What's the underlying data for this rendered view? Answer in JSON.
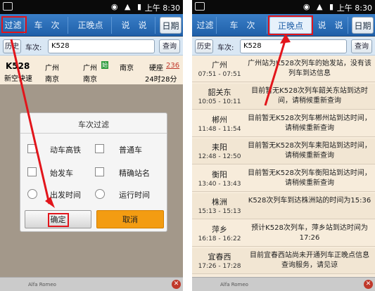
{
  "status_bar": {
    "time": "上午 8:30"
  },
  "left_screen": {
    "tabs": [
      "过滤",
      "车　次",
      "正晚点",
      "说　说",
      "日期"
    ],
    "history_btn": "历史",
    "search_label": "车次:",
    "search_value": "K528",
    "query_btn": "查询",
    "train": {
      "number": "K528",
      "type": "新空快速",
      "from_top": "广州",
      "from_bottom": "南京",
      "via_top": "广州",
      "via_bottom": "南京",
      "badge": "始",
      "to": "南京",
      "seat": "硬座",
      "seat_count": "236",
      "duration": "24时28分"
    },
    "dialog": {
      "title": "车次过滤",
      "options": [
        "动车高铁",
        "普通车",
        "始发车",
        "精确站名"
      ],
      "radios": [
        "出发时间",
        "运行时间"
      ],
      "ok": "确定",
      "cancel": "取消"
    },
    "ad_text": "Alfa Romeo"
  },
  "right_screen": {
    "tabs": [
      "过滤",
      "车　次",
      "正晚点",
      "说　说",
      "日期"
    ],
    "history_btn": "历史",
    "search_label": "车次:",
    "search_value": "K528",
    "query_btn": "查询",
    "rows": [
      {
        "station": "广州",
        "time": "07:51 - 07:51",
        "msg": "广州站为K528次列车的始发站，没有该列车到达信息"
      },
      {
        "station": "韶关东",
        "time": "10:05 - 10:11",
        "msg": "目前暂无K528次列车韶关东站到达时间，请稍候重新查询"
      },
      {
        "station": "郴州",
        "time": "11:48 - 11:54",
        "msg": "目前暂无K528次列车郴州站到达时间，请稍候重新查询"
      },
      {
        "station": "耒阳",
        "time": "12:48 - 12:50",
        "msg": "目前暂无K528次列车耒阳站到达时间，请稍候重新查询"
      },
      {
        "station": "衡阳",
        "time": "13:40 - 13:43",
        "msg": "目前暂无K528次列车衡阳站到达时间，请稍候重新查询"
      },
      {
        "station": "株洲",
        "time": "15:13 - 15:13",
        "msg": "K528次列车到达株洲站的时间为15:36"
      },
      {
        "station": "萍乡",
        "time": "16:18 - 16:22",
        "msg": "预计K528次列车，萍乡站到达时间为17:26"
      },
      {
        "station": "宜春西",
        "time": "17:26 - 17:28",
        "msg": "目前宜春西站尚未开通列车正晚点信息查询服务，请见谅"
      }
    ],
    "ad_text": "Alfa Romeo"
  }
}
